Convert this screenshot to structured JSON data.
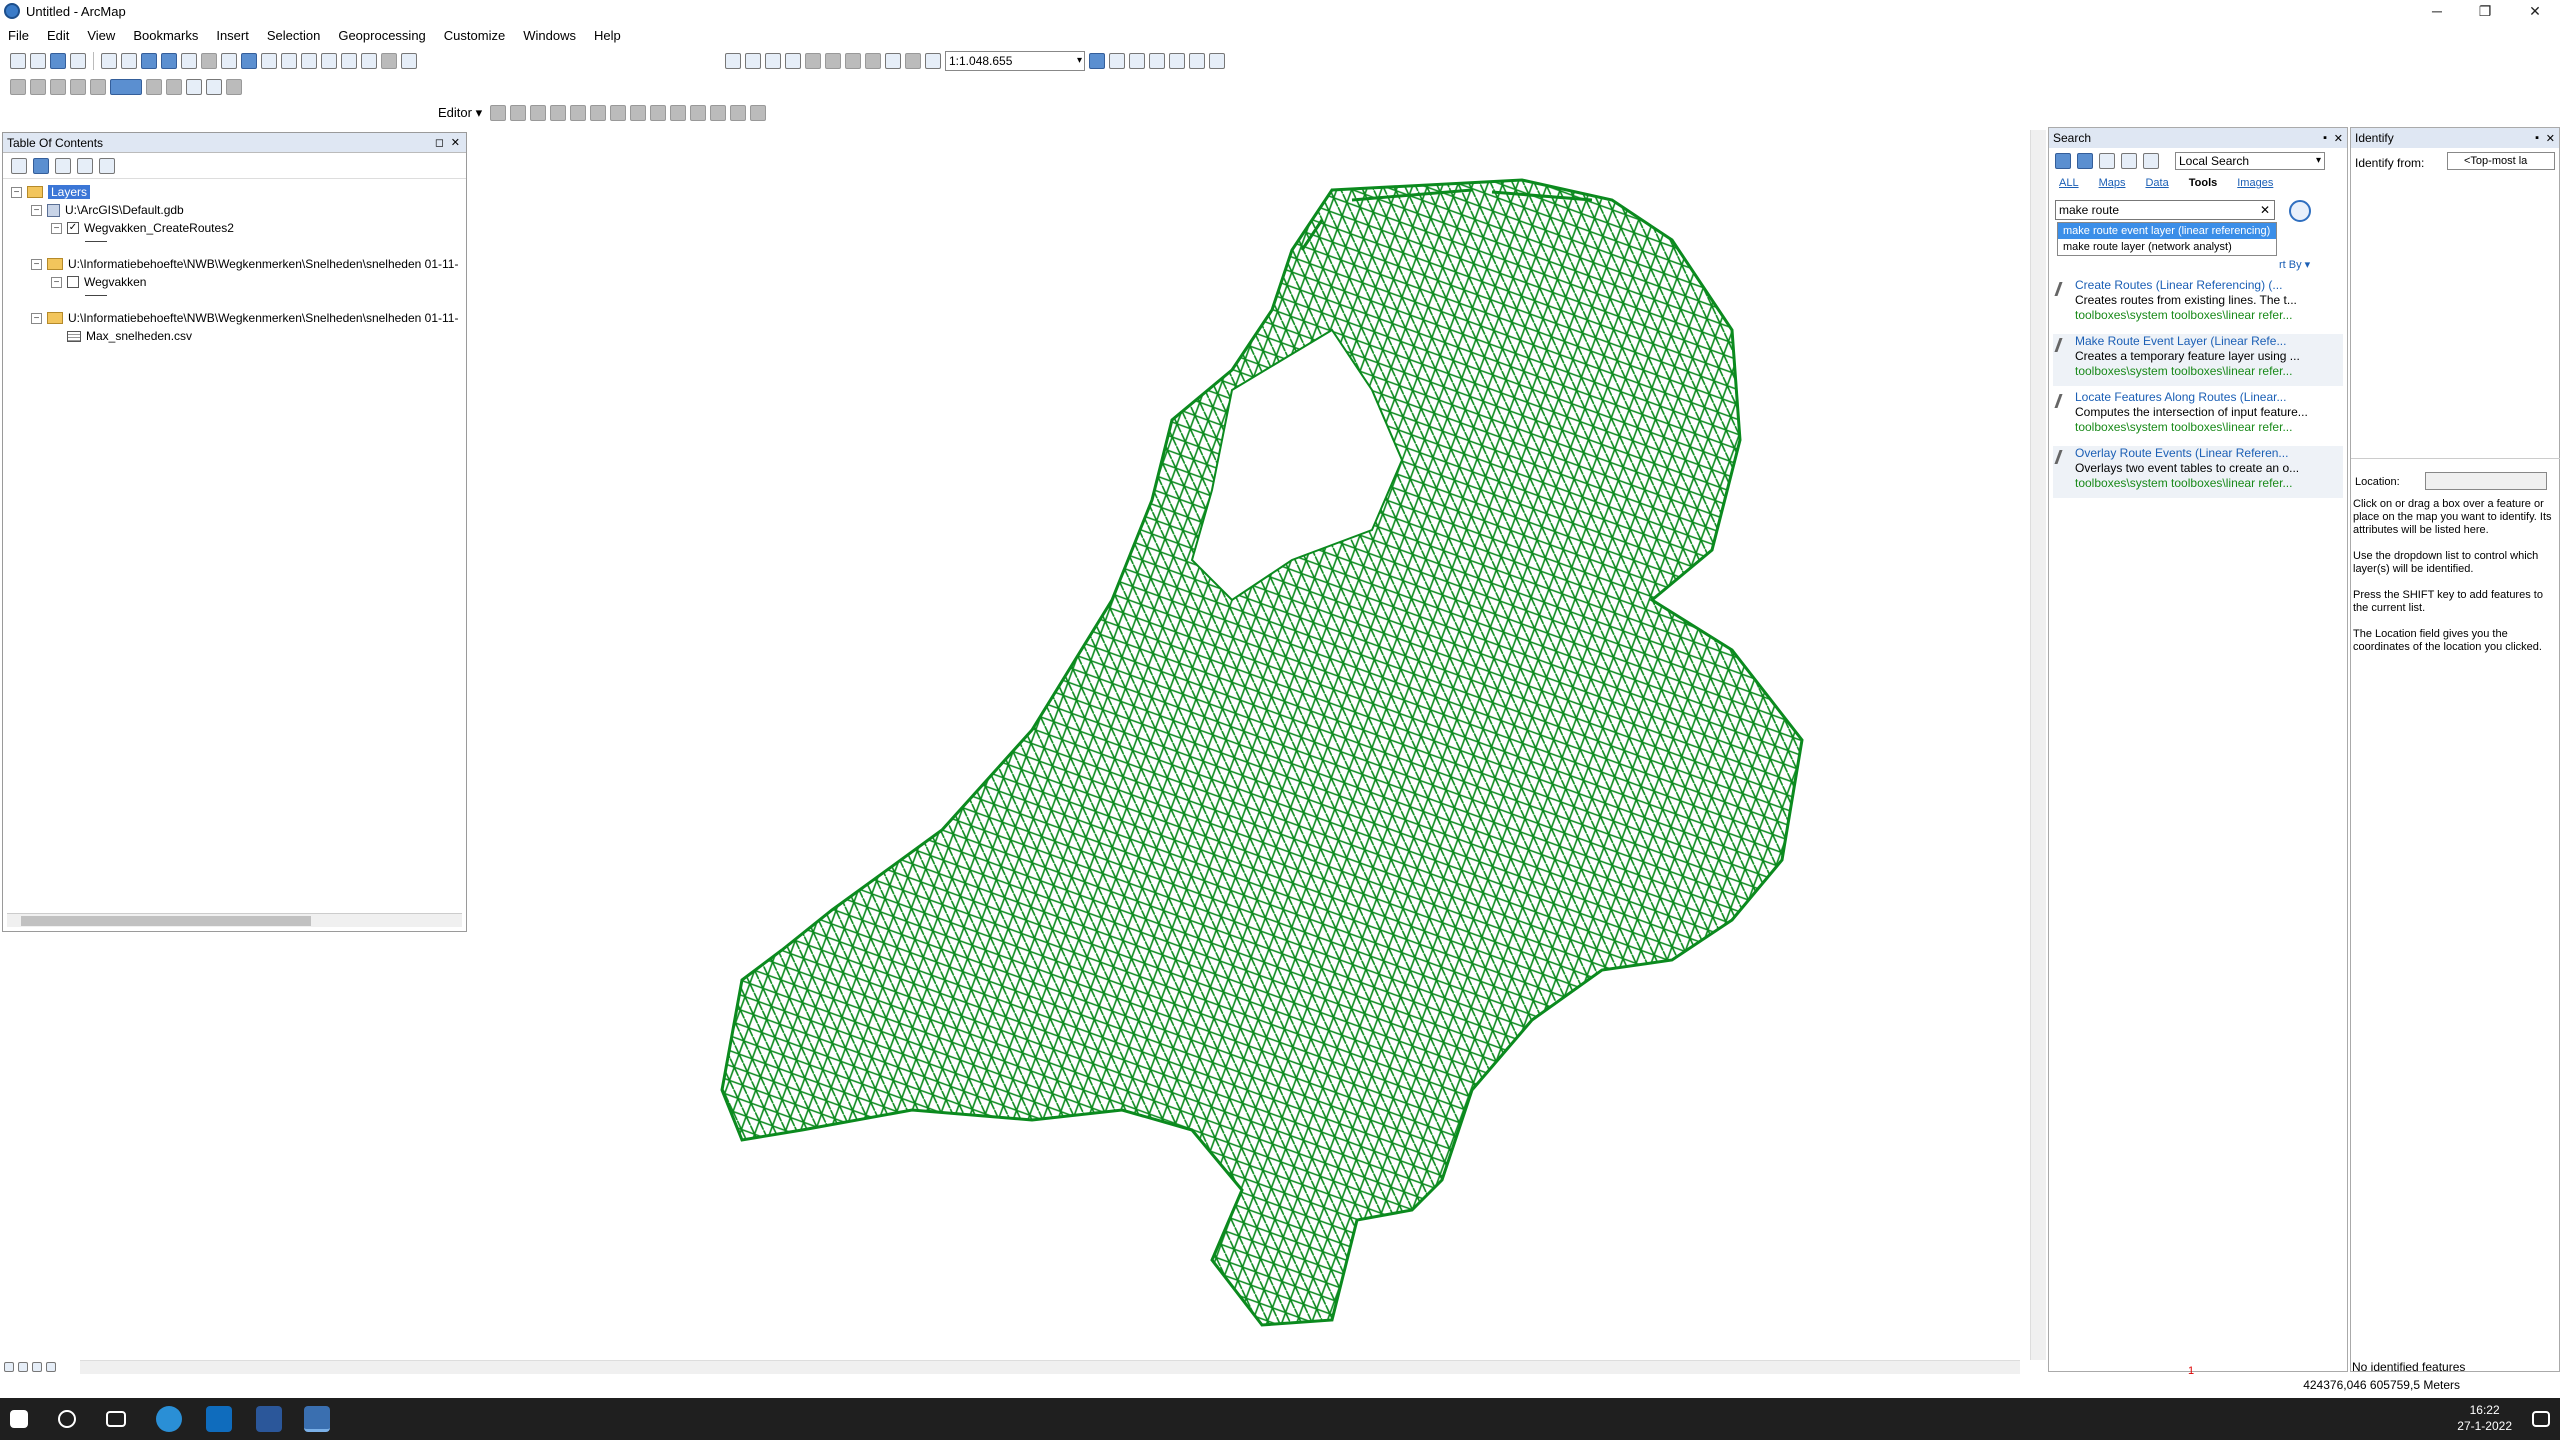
{
  "window": {
    "title": "Untitled - ArcMap",
    "min": "─",
    "max": "❐",
    "close": "✕"
  },
  "menu": [
    "File",
    "Edit",
    "View",
    "Bookmarks",
    "Insert",
    "Selection",
    "Geoprocessing",
    "Customize",
    "Windows",
    "Help"
  ],
  "toolbar": {
    "scale": "1:1.048.655",
    "editor": "Editor ▾"
  },
  "toc": {
    "title": "Table Of Contents",
    "layers_label": "Layers",
    "gdb": "U:\\ArcGIS\\Default.gdb",
    "layer1": "Wegvakken_CreateRoutes2",
    "folder2": "U:\\Informatiebehoefte\\NWB\\Wegkenmerken\\Snelheden\\snelheden 01-11-",
    "layer2": "Wegvakken",
    "folder3": "U:\\Informatiebehoefte\\NWB\\Wegkenmerken\\Snelheden\\snelheden 01-11-",
    "table3": "Max_snelheden.csv"
  },
  "search": {
    "title": "Search",
    "scope": "Local Search",
    "tabs": [
      "ALL",
      "Maps",
      "Data",
      "Tools",
      "Images"
    ],
    "query": "make route",
    "suggestions": [
      "make route event layer (linear referencing)",
      "make route layer (network analyst)"
    ],
    "sort": "rt By ▾",
    "results": [
      {
        "title": "Create Routes (Linear Referencing) (...",
        "desc": "Creates routes from existing lines. The t...",
        "path": "toolboxes\\system toolboxes\\linear refer..."
      },
      {
        "title": "Make Route Event Layer (Linear Refe...",
        "desc": "Creates a temporary feature layer using ...",
        "path": "toolboxes\\system toolboxes\\linear refer..."
      },
      {
        "title": "Locate Features Along Routes (Linear...",
        "desc": "Computes the intersection of input feature...",
        "path": "toolboxes\\system toolboxes\\linear refer..."
      },
      {
        "title": "Overlay Route Events (Linear Referen...",
        "desc": "Overlays two event tables to create an o...",
        "path": "toolboxes\\system toolboxes\\linear refer..."
      }
    ]
  },
  "identify": {
    "title": "Identify",
    "from_label": "Identify from:",
    "from_value": "<Top-most la",
    "location_label": "Location:",
    "help": [
      "Click on or drag a box over a feature or place on the map you want to identify. Its attributes will be listed here.",
      "Use the dropdown list to control which layer(s) will be identified.",
      "Press the SHIFT key to add features to the current list.",
      "The Location field gives you the coordinates of the location you clicked."
    ],
    "none": "No identified features"
  },
  "status": {
    "coords": "424376,046  605759,5 Meters",
    "marker": "1"
  },
  "taskbar": {
    "time": "16:22",
    "date": "27-1-2022"
  },
  "colors": {
    "roads": "#0b8a1e",
    "accent": "#3b8ee8",
    "link": "#1b5fb5"
  }
}
